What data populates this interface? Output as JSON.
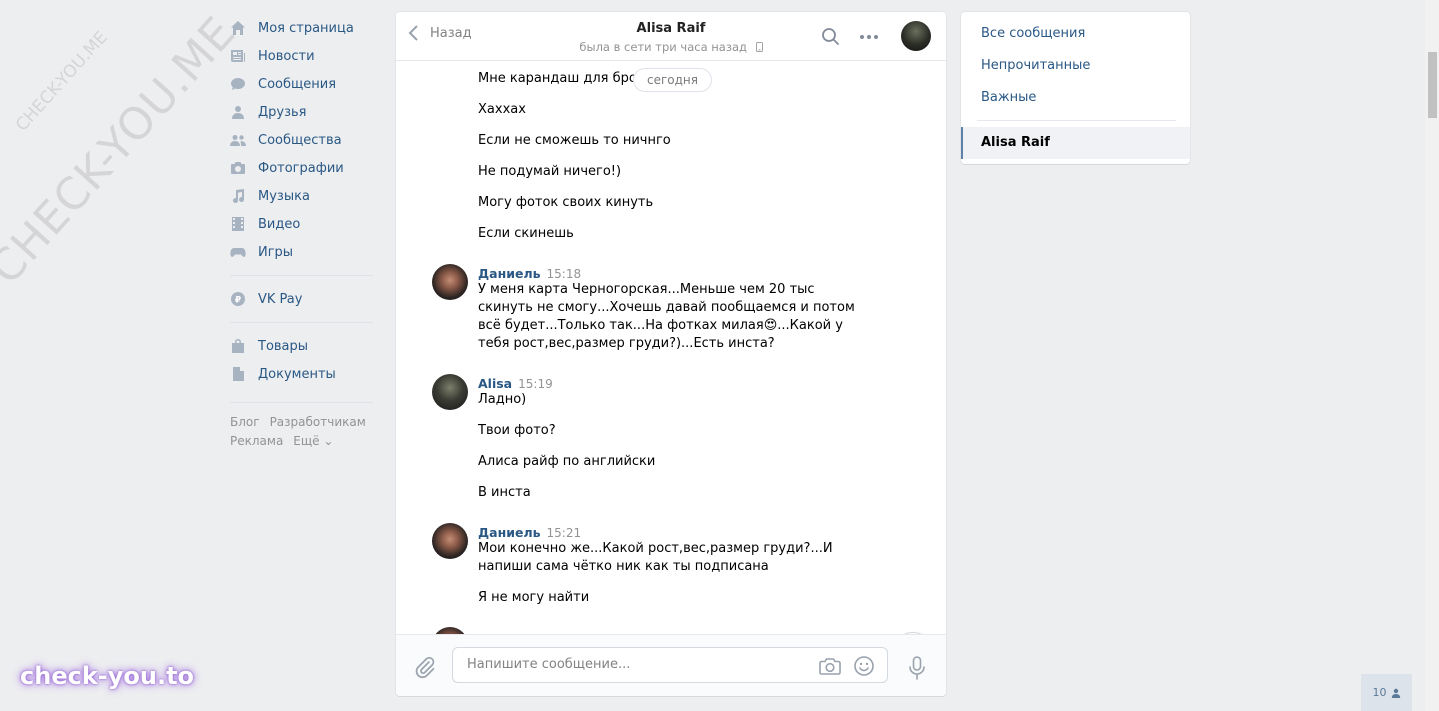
{
  "left_nav": {
    "items": [
      {
        "label": "Моя страница",
        "icon": "home-icon"
      },
      {
        "label": "Новости",
        "icon": "news-icon"
      },
      {
        "label": "Сообщения",
        "icon": "messages-icon"
      },
      {
        "label": "Друзья",
        "icon": "friends-icon"
      },
      {
        "label": "Сообщества",
        "icon": "groups-icon"
      },
      {
        "label": "Фотографии",
        "icon": "camera-icon"
      },
      {
        "label": "Музыка",
        "icon": "music-icon"
      },
      {
        "label": "Видео",
        "icon": "video-icon"
      },
      {
        "label": "Игры",
        "icon": "gamepad-icon"
      }
    ],
    "vkpay": {
      "label": "VK Pay",
      "icon": "vkpay-icon"
    },
    "bottom_items": [
      {
        "label": "Товары",
        "icon": "bag-icon"
      },
      {
        "label": "Документы",
        "icon": "document-icon"
      }
    ],
    "footer": {
      "blog": "Блог",
      "developers": "Разработчикам",
      "ads": "Реклама",
      "more": "Ещё ⌄"
    }
  },
  "chat": {
    "back_label": "Назад",
    "peer_name": "Alisa Raif",
    "peer_status": "была в сети три часа назад",
    "date_pill": "сегодня",
    "messages": [
      {
        "kind": "text",
        "text": "Мне карандаш для брове          то"
      },
      {
        "kind": "text",
        "text": "Хаххах"
      },
      {
        "kind": "text",
        "text": "Если не сможешь то ничнго"
      },
      {
        "kind": "text",
        "text": "Не подумай ничего!)"
      },
      {
        "kind": "text",
        "text": "Могу фоток своих кинуть"
      },
      {
        "kind": "text",
        "text": "Если скинешь"
      },
      {
        "kind": "head",
        "author": "Даниель",
        "time": "15:18"
      },
      {
        "kind": "text",
        "text": "У меня карта Черногорская...Меньше чем 20 тыс скинуть не смогу...Хочешь давай пообщаемся и потом всё будет...Только так...На фотках милая😍...Какой у тебя рост,вес,размер груди?)...Есть инста?"
      },
      {
        "kind": "head",
        "author": "Alisa",
        "time": "15:19"
      },
      {
        "kind": "text",
        "text": "Ладно)"
      },
      {
        "kind": "text",
        "text": "Твои фото?"
      },
      {
        "kind": "text",
        "text": "Алиса райф по английски"
      },
      {
        "kind": "text",
        "text": "В инста"
      },
      {
        "kind": "head",
        "author": "Даниель",
        "time": "15:21"
      },
      {
        "kind": "text",
        "text": "Мои конечно же...Какой рост,вес,размер груди?...И напиши сама чётко ник как ты подписана"
      },
      {
        "kind": "text",
        "text": "Я не могу найти"
      }
    ],
    "composer": {
      "placeholder": "Напишите сообщение..."
    }
  },
  "right_panel": {
    "filters": [
      "Все сообщения",
      "Непрочитанные",
      "Важные"
    ],
    "selected_conversation": "Alisa Raif"
  },
  "online_badge": {
    "count": "10"
  },
  "watermarks": {
    "diagonal_big": "CHECK-YOU.ME",
    "diagonal_small": "CHECK-YOU.ME",
    "logo": "check-you.to"
  },
  "colors": {
    "link": "#2a5885",
    "background": "#edeef0",
    "icon": "#a8b3c2",
    "secondary_text": "#939393"
  }
}
